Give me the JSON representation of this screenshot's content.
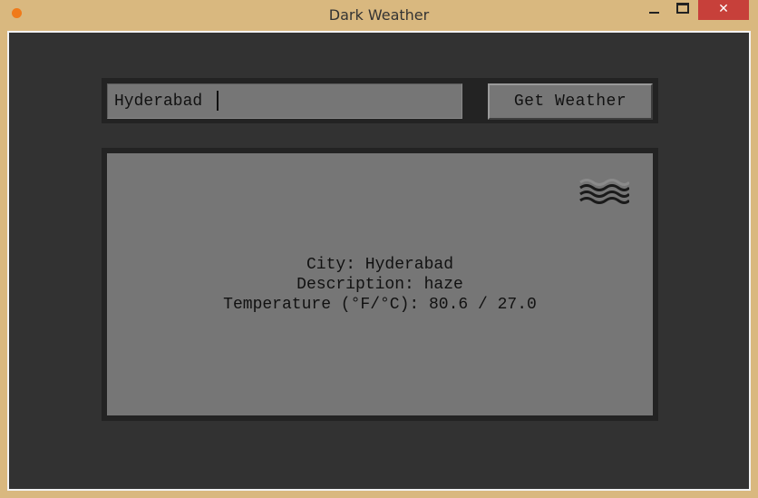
{
  "window": {
    "title": "Dark Weather",
    "close_label": "✕"
  },
  "search": {
    "city_value": "Hyderabad",
    "button_label": "Get Weather"
  },
  "result": {
    "icon": "haze-icon",
    "city_line": "City: Hyderabad",
    "description_line": "Description: haze",
    "temperature_line": "Temperature (°F/°C): 80.6 / 27.0"
  },
  "colors": {
    "titlebar": "#d9b87f",
    "background": "#323232",
    "panel": "#767676",
    "close": "#c7403a"
  }
}
